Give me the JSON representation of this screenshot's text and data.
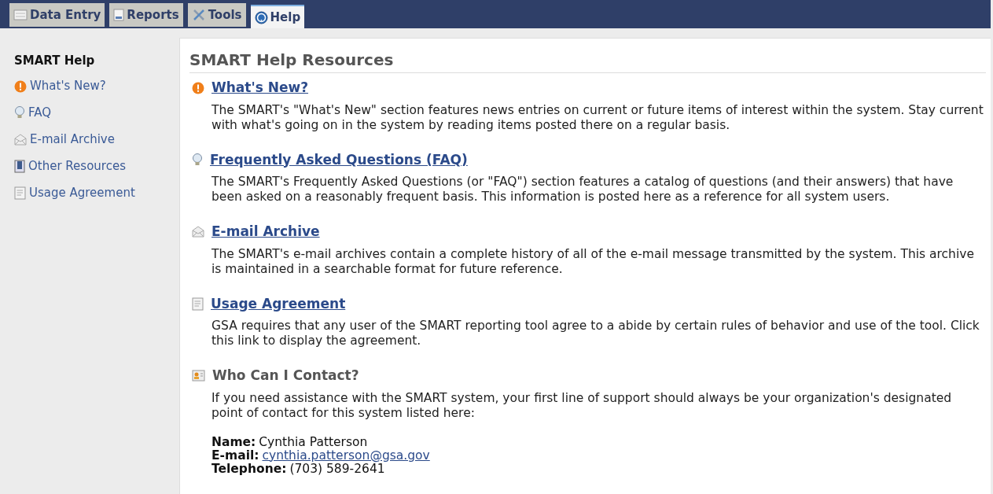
{
  "tabs": [
    {
      "label": "Data Entry",
      "kind": "form",
      "selected": false
    },
    {
      "label": "Reports",
      "kind": "report",
      "selected": false
    },
    {
      "label": "Tools",
      "kind": "tools",
      "selected": false
    },
    {
      "label": "Help",
      "kind": "help",
      "selected": true
    }
  ],
  "sidebar": {
    "title": "SMART Help",
    "items": [
      {
        "label": "What's New?",
        "kind": "alert"
      },
      {
        "label": "FAQ",
        "kind": "bulb"
      },
      {
        "label": "E-mail Archive",
        "kind": "mail"
      },
      {
        "label": "Other Resources",
        "kind": "book"
      },
      {
        "label": "Usage Agreement",
        "kind": "page"
      }
    ]
  },
  "content": {
    "title": "SMART Help Resources",
    "sections": [
      {
        "kind": "alert",
        "heading": "What's New?",
        "link": true,
        "text": "The SMART's \"What's New\" section features news entries on current or future items of interest within the system. Stay current with what's going on in the system by reading items posted there on a regular basis."
      },
      {
        "kind": "bulb",
        "heading": "Frequently Asked Questions (FAQ)",
        "link": true,
        "text": "The SMART's Frequently Asked Questions (or \"FAQ\") section features a catalog of questions (and their answers) that have been asked on a reasonably frequent basis. This information is posted here as a reference for all system users."
      },
      {
        "kind": "mail",
        "heading": "E-mail Archive",
        "link": true,
        "text": "The SMART's e-mail archives contain a complete history of all of the e-mail message transmitted by the system. This archive is maintained in a searchable format for future reference."
      },
      {
        "kind": "page",
        "heading": "Usage Agreement",
        "link": true,
        "text": "GSA requires that any user of the SMART reporting tool agree to a abide by certain rules of behavior and use of the tool. Click this link to display the agreement."
      },
      {
        "kind": "contact",
        "heading": "Who Can I Contact?",
        "link": false,
        "text": "If you need assistance with the SMART system, your first line of support should always be your organization's designated point of contact for this system listed here:"
      }
    ],
    "contact": [
      {
        "label": "Name:",
        "value": "Cynthia Patterson",
        "kind": "text"
      },
      {
        "label": "E-mail:",
        "value": "cynthia.patterson@gsa.gov",
        "kind": "link"
      },
      {
        "label": "Telephone:",
        "value": "(703) 589-2641",
        "kind": "text"
      }
    ]
  }
}
